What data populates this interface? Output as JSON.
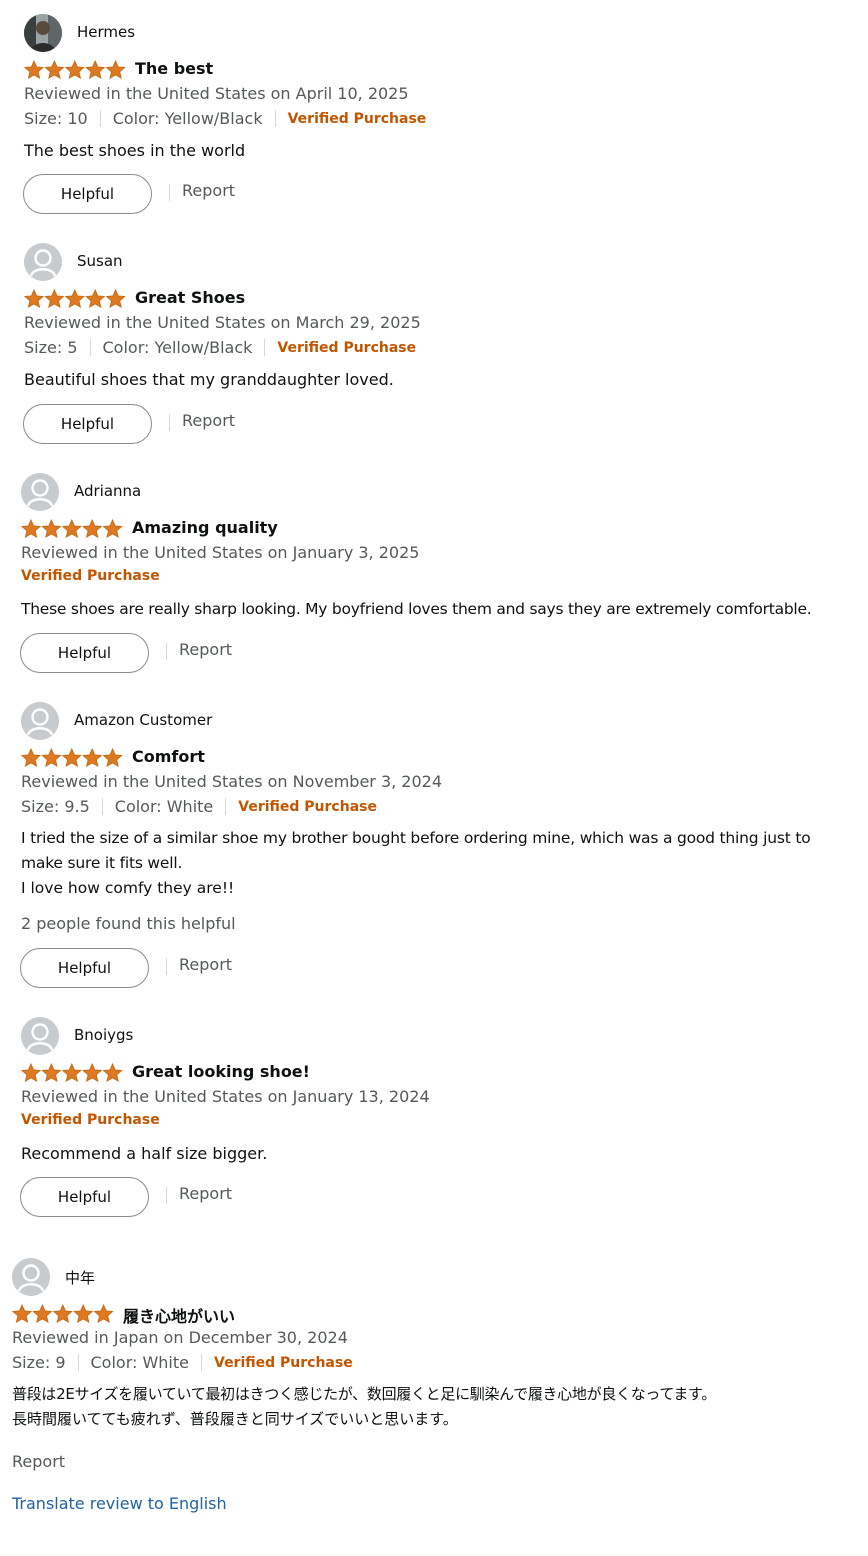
{
  "reviews": [
    {
      "name": "Hermes",
      "avatar": "photo",
      "rating": 5,
      "title": "The best",
      "date": "Reviewed in the United States on April 10, 2025",
      "size": "Size: 10",
      "color": "Color: Yellow/Black",
      "verified": "Verified Purchase",
      "body": [
        "The best shoes in the world"
      ],
      "helpful_label": "Helpful",
      "report_label": "Report"
    },
    {
      "name": "Susan",
      "avatar": "default",
      "rating": 5,
      "title": "Great Shoes",
      "date": "Reviewed in the United States on March 29, 2025",
      "size": "Size: 5",
      "color": "Color: Yellow/Black",
      "verified": "Verified Purchase",
      "body": [
        "Beautiful shoes that my granddaughter loved."
      ],
      "helpful_label": "Helpful",
      "report_label": "Report"
    },
    {
      "name": "Adrianna",
      "avatar": "default",
      "rating": 5,
      "title": "Amazing quality",
      "date": "Reviewed in the United States on January 3, 2025",
      "verified": "Verified Purchase",
      "body": [
        "These shoes are really sharp looking. My boyfriend loves them and says they are extremely comfortable."
      ],
      "helpful_label": "Helpful",
      "report_label": "Report"
    },
    {
      "name": "Amazon Customer",
      "avatar": "default",
      "rating": 5,
      "title": "Comfort",
      "date": "Reviewed in the United States on November 3, 2024",
      "size": "Size: 9.5",
      "color": "Color: White",
      "verified": "Verified Purchase",
      "body": [
        "I tried the size of a similar shoe my brother bought before ordering mine, which was a good thing just to make sure it fits well.",
        "I love how comfy they are!!"
      ],
      "helpful_count": "2 people found this helpful",
      "helpful_label": "Helpful",
      "report_label": "Report"
    },
    {
      "name": "Bnoiygs",
      "avatar": "default",
      "rating": 5,
      "title": "Great looking shoe!",
      "date": "Reviewed in the United States on January 13, 2024",
      "verified": "Verified Purchase",
      "body": [
        "Recommend a half size bigger."
      ],
      "helpful_label": "Helpful",
      "report_label": "Report"
    },
    {
      "name": "中年",
      "avatar": "default",
      "rating": 5,
      "title": "履き心地がいい",
      "date": "Reviewed in Japan on December 30, 2024",
      "size": "Size: 9",
      "color": "Color: White",
      "verified": "Verified Purchase",
      "body": [
        "普段は2Eサイズを履いていて最初はきつく感じたが、数回履くと足に馴染んで履き心地が良くなってます。",
        "長時間履いてても疲れず、普段履きと同サイズでいいと思います。"
      ],
      "report_label": "Report",
      "translate_label": "Translate review to English"
    }
  ],
  "colors": {
    "star": "#de7921",
    "verified": "#c45500",
    "link": "#2162a1",
    "muted": "#565959"
  }
}
